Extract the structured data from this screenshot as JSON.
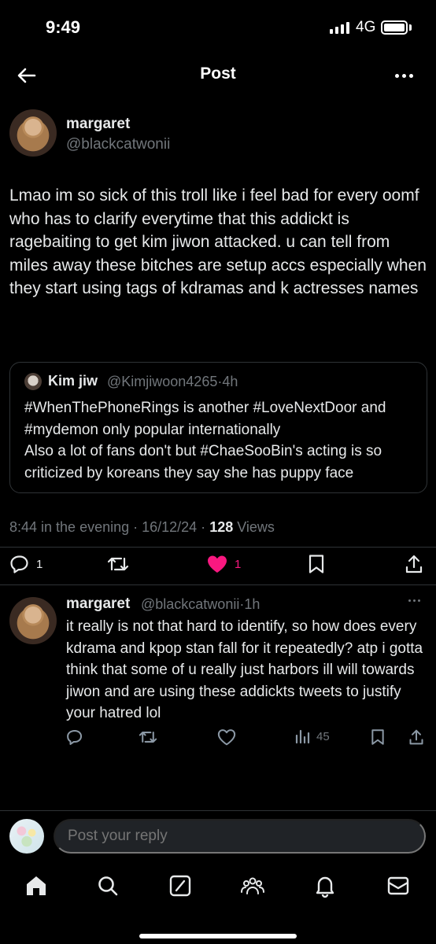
{
  "status_bar": {
    "time": "9:49",
    "network": "4G"
  },
  "header": {
    "title": "Post"
  },
  "post": {
    "author_name": "margaret",
    "author_handle": "@blackcatwonii",
    "text": "Lmao im so sick of this troll like i feel bad for every oomf who has to clarify everytime that this addickt is ragebaiting to get kim jiwon attacked. u can tell from miles away these bitches are setup accs especially when they start using tags of kdramas and k actresses names",
    "quote": {
      "name": "Kim jiw",
      "handle": "@Kimjiwoon4265",
      "separator": "·",
      "time": "4h",
      "text": "#WhenThePhoneRings is another #LoveNextDoor and #mydemon only popular internationally\nAlso a lot of fans don't but #ChaeSooBin's acting is so criticized by koreans they say she has puppy face"
    },
    "timestamp_text": "8:44 in the evening · 16/12/24 · ",
    "views_count": "128",
    "views_label": " Views",
    "actions": {
      "replies": "1",
      "likes": "1",
      "like_color": "#f91880"
    }
  },
  "reply": {
    "author_name": "margaret",
    "author_handle": "@blackcatwonii",
    "separator": "·",
    "time": "1h",
    "text": "it really is not that hard to identify, so how does every kdrama and kpop stan fall for it repeatedly? atp i gotta think that some of u really just harbors ill will towards jiwon and are using these addickts tweets to justify your hatred lol",
    "views": "45"
  },
  "composer": {
    "placeholder": "Post your reply"
  },
  "nav": {
    "items": [
      "home-icon",
      "search-icon",
      "grok-icon",
      "communities-icon",
      "notifications-icon",
      "messages-icon"
    ]
  }
}
